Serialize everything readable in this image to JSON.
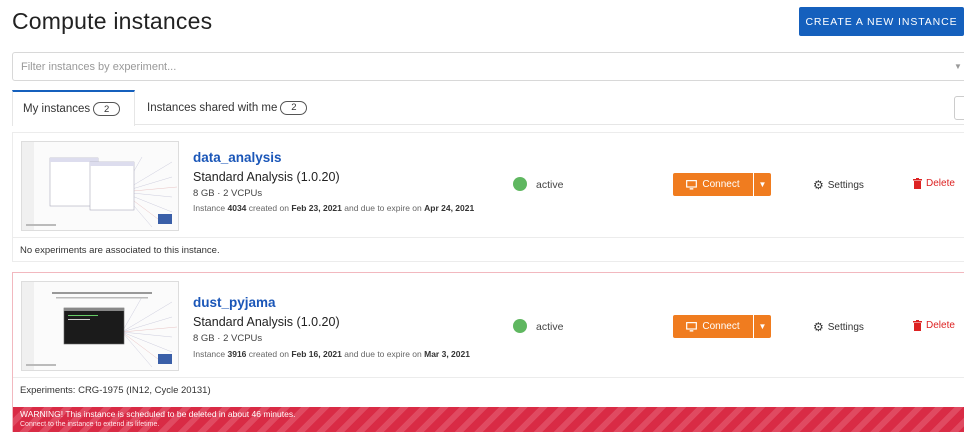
{
  "header": {
    "title": "Compute instances",
    "create_label": "CREATE A NEW INSTANCE"
  },
  "filter": {
    "placeholder": "Filter instances by experiment..."
  },
  "tabs": [
    {
      "label": "My instances",
      "count": "2",
      "active": true
    },
    {
      "label": "Instances shared with me",
      "count": "2",
      "active": false
    }
  ],
  "instances": [
    {
      "name": "data_analysis",
      "type": "Standard Analysis (1.0.20)",
      "spec": "8 GB · 2 VCPUs",
      "meta_prefix": "Instance ",
      "instance_id": "4034",
      "meta_created": " created on ",
      "created": "Feb 23, 2021",
      "meta_expire": " and due to expire on ",
      "expires": "Apr 24, 2021",
      "status": "active",
      "connect_label": "Connect",
      "settings_label": "Settings",
      "delete_label": "Delete",
      "experiments_text": "No experiments are associated to this instance.",
      "thumb_text": "This machine is to be used for data analysis purposes only"
    },
    {
      "name": "dust_pyjama",
      "type": "Standard Analysis (1.0.20)",
      "spec": "8 GB · 2 VCPUs",
      "meta_prefix": "Instance ",
      "instance_id": "3916",
      "meta_created": " created on ",
      "created": "Feb 16, 2021",
      "meta_expire": " and due to expire on ",
      "expires": "Mar 3, 2021",
      "status": "active",
      "connect_label": "Connect",
      "settings_label": "Settings",
      "delete_label": "Delete",
      "experiments_label": "Experiments:",
      "experiments_value": " CRG-1975 (IN12, Cycle 20131)",
      "warning_line1": "WARNING! This instance is scheduled to be deleted in about 46 minutes.",
      "warning_line2": "Connect to the instance to extend its lifetime.",
      "thumb_text": "This machine is to be used for data analysis purposes only"
    }
  ],
  "colors": {
    "primary": "#1560bd",
    "connect": "#f07c1f",
    "active": "#5fb760",
    "danger": "#d22222",
    "warning": "#d92b45"
  }
}
